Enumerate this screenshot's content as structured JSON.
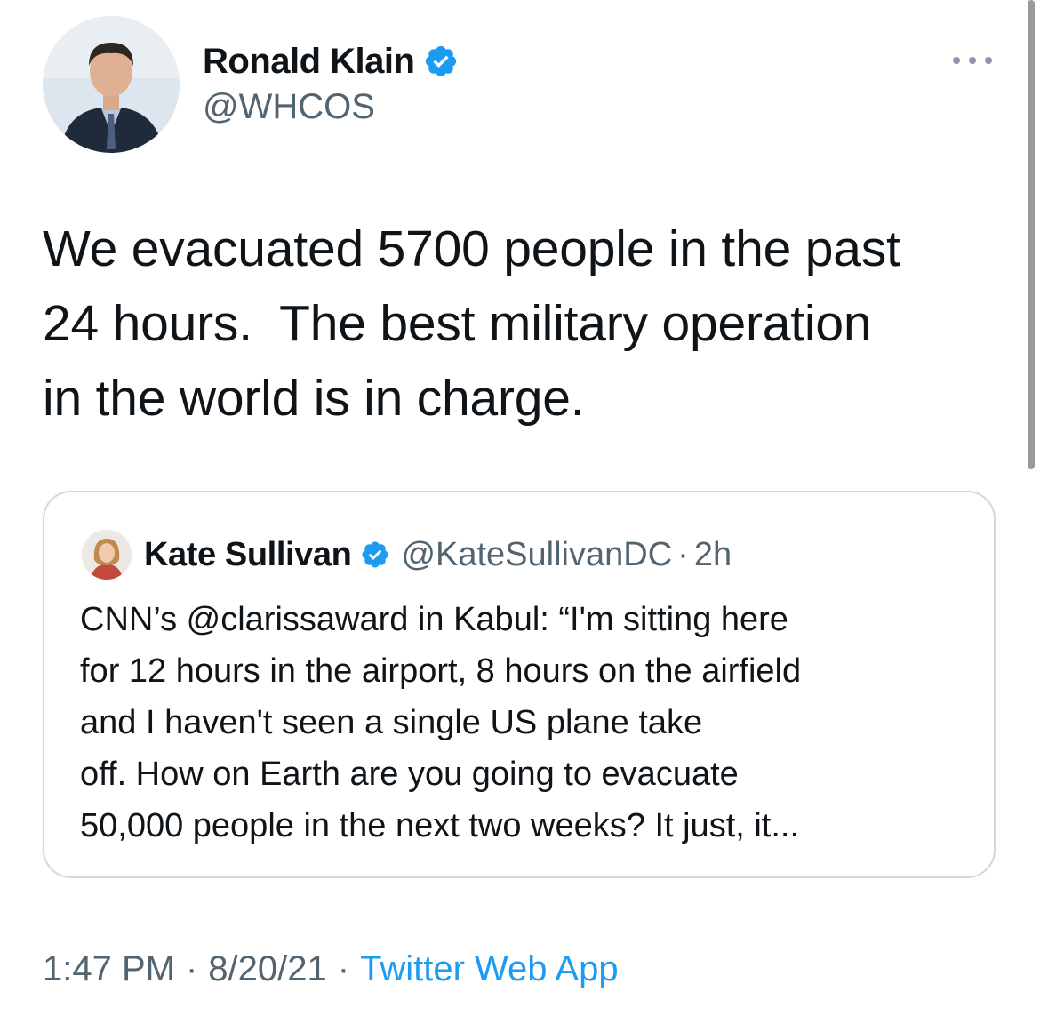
{
  "tweet": {
    "author": {
      "name": "Ronald Klain",
      "handle": "@WHCOS",
      "verified": true,
      "avatar_icon": "profile-photo"
    },
    "more_icon": "ellipsis-icon",
    "text": "We evacuated 5700 people in the past\n24 hours.  The best military operation\nin the world is in charge.",
    "quoted": {
      "author": {
        "name": "Kate Sullivan",
        "handle": "@KateSullivanDC",
        "verified": true
      },
      "separator": "·",
      "time": "2h",
      "text": "CNN’s @clarissaward in Kabul: “I'm sitting here\nfor 12 hours in the airport, 8 hours on the airfield\nand I haven't seen a single US plane take\noff. How on Earth are you going to evacuate\n50,000 people in the next two weeks? It just, it..."
    },
    "meta": {
      "time": "1:47 PM",
      "separator": "·",
      "date": "8/20/21",
      "source": "Twitter Web App"
    }
  },
  "colors": {
    "verified_badge": "#1d9bf0",
    "link": "#1d9bf0",
    "secondary_text": "#536471",
    "card_border": "#cfd9de"
  }
}
